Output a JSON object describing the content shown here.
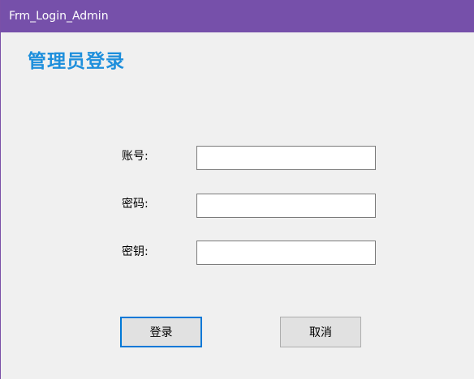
{
  "window": {
    "title": "Frm_Login_Admin"
  },
  "heading": "管理员登录",
  "form": {
    "account_label": "账号:",
    "account_value": "",
    "password_label": "密码:",
    "password_value": "",
    "key_label": "密钥:",
    "key_value": ""
  },
  "buttons": {
    "login_label": "登录",
    "cancel_label": "取消"
  },
  "colors": {
    "titlebar": "#7650aa",
    "heading": "#1e8fdc",
    "focus_border": "#0078d7"
  }
}
